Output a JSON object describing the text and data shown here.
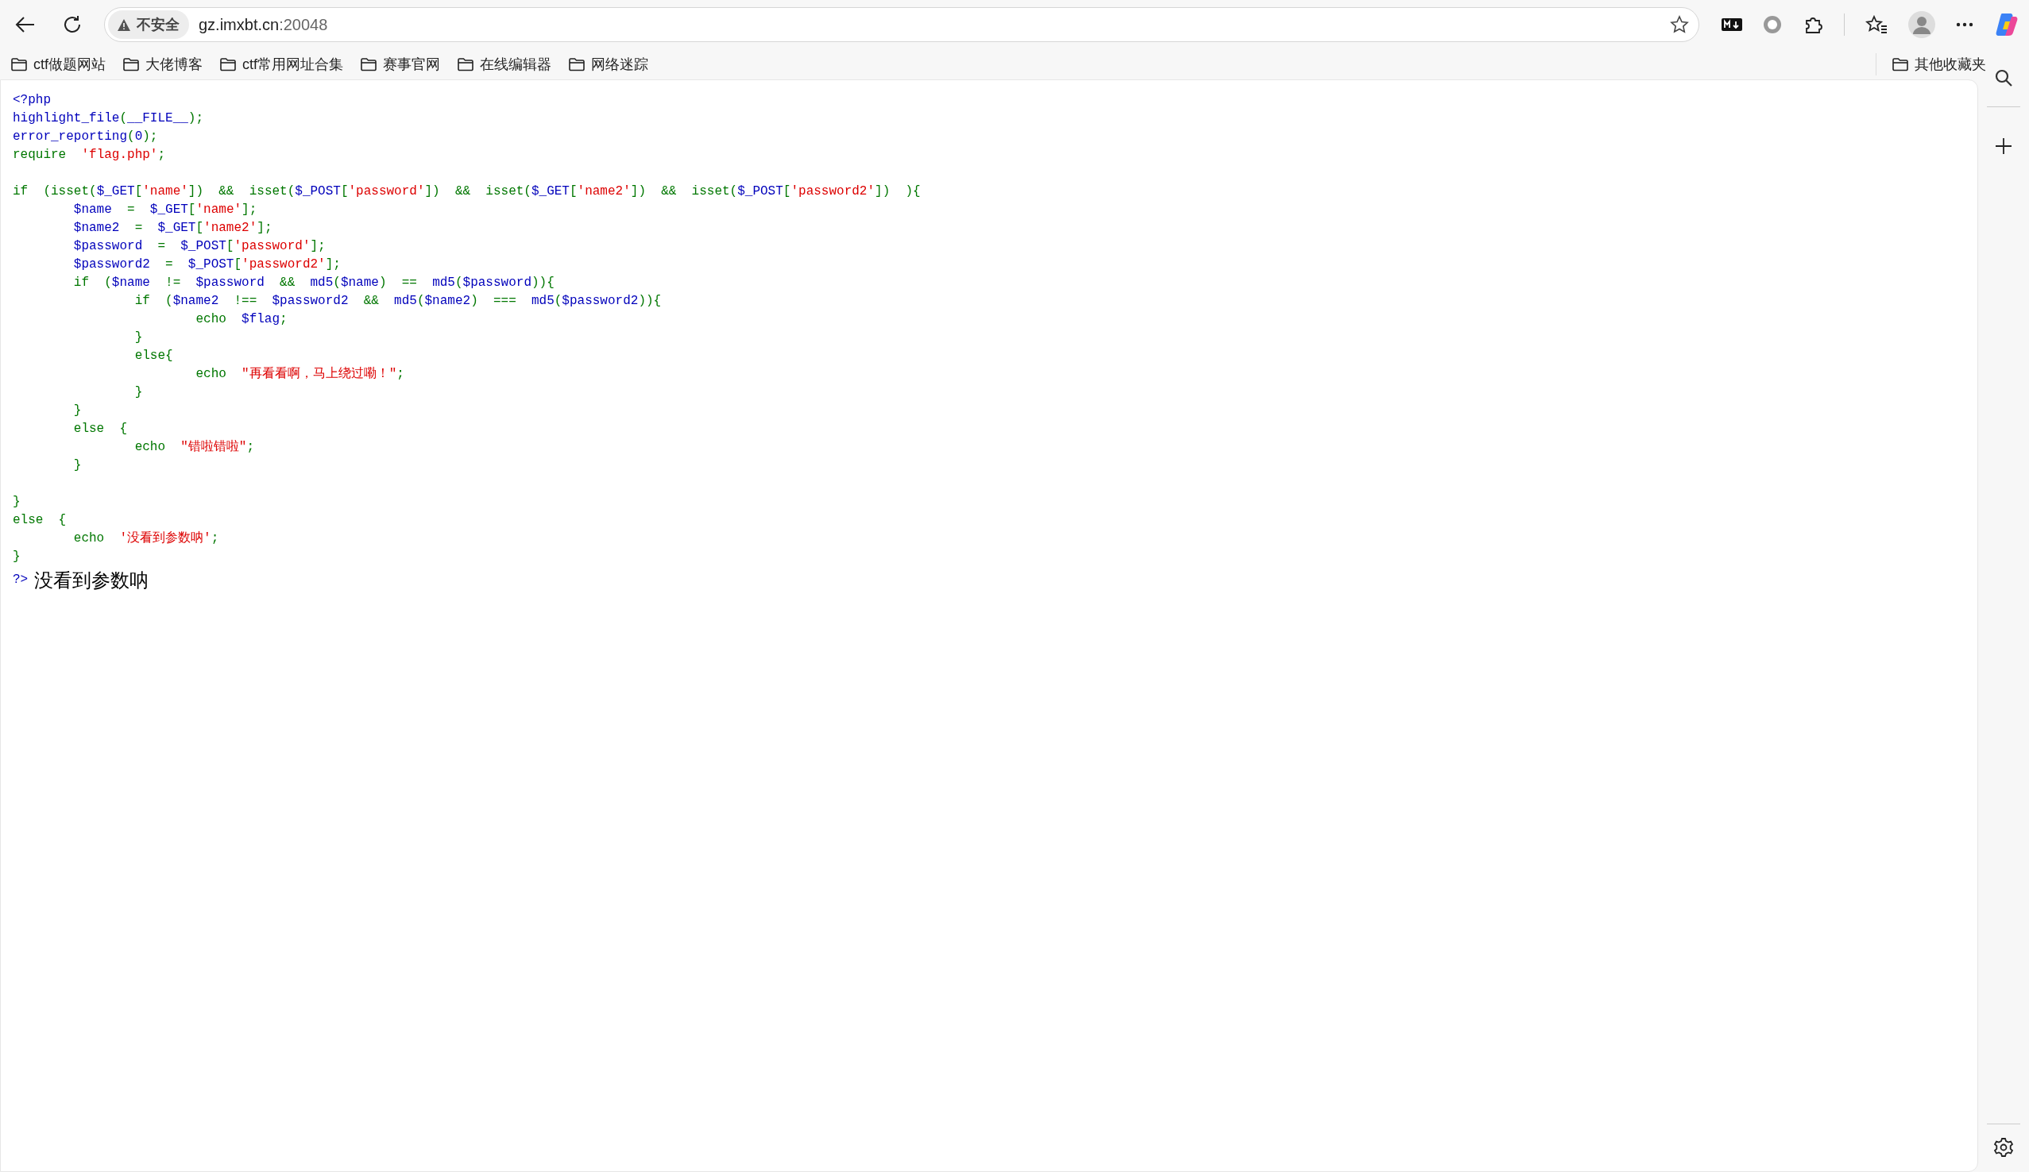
{
  "browser": {
    "address_bar": {
      "security_label": "不安全",
      "host": "gz.imxbt.cn",
      "port": ":20048"
    },
    "bookmarks": [
      {
        "label": "ctf做题网站"
      },
      {
        "label": "大佬博客"
      },
      {
        "label": "ctf常用网址合集"
      },
      {
        "label": "赛事官网"
      },
      {
        "label": "在线编辑器"
      },
      {
        "label": "网络迷踪"
      }
    ],
    "other_bookmarks": "其他收藏夹"
  },
  "code": {
    "blocks": [
      {
        "lines": [
          [
            {
              "kind": "default",
              "text": "<?php"
            }
          ],
          [
            {
              "kind": "default",
              "text": "highlight_file"
            },
            {
              "kind": "keyword",
              "text": "("
            },
            {
              "kind": "default",
              "text": "__FILE__"
            },
            {
              "kind": "keyword",
              "text": ");"
            }
          ],
          [
            {
              "kind": "default",
              "text": "error_reporting"
            },
            {
              "kind": "keyword",
              "text": "("
            },
            {
              "kind": "default",
              "text": "0"
            },
            {
              "kind": "keyword",
              "text": ");"
            }
          ],
          [
            {
              "kind": "keyword",
              "text": "require  "
            },
            {
              "kind": "string",
              "text": "'flag.php'"
            },
            {
              "kind": "keyword",
              "text": ";"
            }
          ]
        ]
      },
      {
        "lines": [
          [
            {
              "kind": "keyword",
              "text": "if  (isset("
            },
            {
              "kind": "default",
              "text": "$_GET"
            },
            {
              "kind": "keyword",
              "text": "["
            },
            {
              "kind": "string",
              "text": "'name'"
            },
            {
              "kind": "keyword",
              "text": "])  &&  isset("
            },
            {
              "kind": "default",
              "text": "$_POST"
            },
            {
              "kind": "keyword",
              "text": "["
            },
            {
              "kind": "string",
              "text": "'password'"
            },
            {
              "kind": "keyword",
              "text": "])  &&  isset("
            },
            {
              "kind": "default",
              "text": "$_GET"
            },
            {
              "kind": "keyword",
              "text": "["
            },
            {
              "kind": "string",
              "text": "'name2'"
            },
            {
              "kind": "keyword",
              "text": "])  &&  isset("
            },
            {
              "kind": "default",
              "text": "$_POST"
            },
            {
              "kind": "keyword",
              "text": "["
            },
            {
              "kind": "string",
              "text": "'password2'"
            },
            {
              "kind": "keyword",
              "text": "])  ){"
            }
          ],
          [
            {
              "kind": "default",
              "text": "        $name  "
            },
            {
              "kind": "keyword",
              "text": "=  "
            },
            {
              "kind": "default",
              "text": "$_GET"
            },
            {
              "kind": "keyword",
              "text": "["
            },
            {
              "kind": "string",
              "text": "'name'"
            },
            {
              "kind": "keyword",
              "text": "];"
            }
          ],
          [
            {
              "kind": "default",
              "text": "        $name2  "
            },
            {
              "kind": "keyword",
              "text": "=  "
            },
            {
              "kind": "default",
              "text": "$_GET"
            },
            {
              "kind": "keyword",
              "text": "["
            },
            {
              "kind": "string",
              "text": "'name2'"
            },
            {
              "kind": "keyword",
              "text": "];"
            }
          ],
          [
            {
              "kind": "default",
              "text": "        $password  "
            },
            {
              "kind": "keyword",
              "text": "=  "
            },
            {
              "kind": "default",
              "text": "$_POST"
            },
            {
              "kind": "keyword",
              "text": "["
            },
            {
              "kind": "string",
              "text": "'password'"
            },
            {
              "kind": "keyword",
              "text": "];"
            }
          ],
          [
            {
              "kind": "default",
              "text": "        $password2  "
            },
            {
              "kind": "keyword",
              "text": "=  "
            },
            {
              "kind": "default",
              "text": "$_POST"
            },
            {
              "kind": "keyword",
              "text": "["
            },
            {
              "kind": "string",
              "text": "'password2'"
            },
            {
              "kind": "keyword",
              "text": "];"
            }
          ],
          [
            {
              "kind": "keyword",
              "text": "        if  ("
            },
            {
              "kind": "default",
              "text": "$name  "
            },
            {
              "kind": "keyword",
              "text": "!=  "
            },
            {
              "kind": "default",
              "text": "$password  "
            },
            {
              "kind": "keyword",
              "text": "&&  "
            },
            {
              "kind": "default",
              "text": "md5"
            },
            {
              "kind": "keyword",
              "text": "("
            },
            {
              "kind": "default",
              "text": "$name"
            },
            {
              "kind": "keyword",
              "text": ")  ==  "
            },
            {
              "kind": "default",
              "text": "md5"
            },
            {
              "kind": "keyword",
              "text": "("
            },
            {
              "kind": "default",
              "text": "$password"
            },
            {
              "kind": "keyword",
              "text": ")){"
            }
          ],
          [
            {
              "kind": "keyword",
              "text": "                if  ("
            },
            {
              "kind": "default",
              "text": "$name2  "
            },
            {
              "kind": "keyword",
              "text": "!==  "
            },
            {
              "kind": "default",
              "text": "$password2  "
            },
            {
              "kind": "keyword",
              "text": "&&  "
            },
            {
              "kind": "default",
              "text": "md5"
            },
            {
              "kind": "keyword",
              "text": "("
            },
            {
              "kind": "default",
              "text": "$name2"
            },
            {
              "kind": "keyword",
              "text": ")  ===  "
            },
            {
              "kind": "default",
              "text": "md5"
            },
            {
              "kind": "keyword",
              "text": "("
            },
            {
              "kind": "default",
              "text": "$password2"
            },
            {
              "kind": "keyword",
              "text": ")){"
            }
          ],
          [
            {
              "kind": "keyword",
              "text": "                        echo  "
            },
            {
              "kind": "default",
              "text": "$flag"
            },
            {
              "kind": "keyword",
              "text": ";"
            }
          ],
          [
            {
              "kind": "keyword",
              "text": "                }"
            }
          ],
          [
            {
              "kind": "keyword",
              "text": "                else{"
            }
          ],
          [
            {
              "kind": "keyword",
              "text": "                        echo  "
            },
            {
              "kind": "string",
              "text": "\"再看看啊，马上绕过嘞！\""
            },
            {
              "kind": "keyword",
              "text": ";"
            }
          ],
          [
            {
              "kind": "keyword",
              "text": "                }"
            }
          ],
          [
            {
              "kind": "keyword",
              "text": "        }"
            }
          ],
          [
            {
              "kind": "keyword",
              "text": "        else  {"
            }
          ],
          [
            {
              "kind": "keyword",
              "text": "                echo  "
            },
            {
              "kind": "string",
              "text": "\"错啦错啦\""
            },
            {
              "kind": "keyword",
              "text": ";"
            }
          ],
          [
            {
              "kind": "keyword",
              "text": "        }"
            }
          ]
        ]
      },
      {
        "lines": [
          [
            {
              "kind": "keyword",
              "text": "}"
            }
          ],
          [
            {
              "kind": "keyword",
              "text": "else  {"
            }
          ],
          [
            {
              "kind": "keyword",
              "text": "        echo  "
            },
            {
              "kind": "string",
              "text": "'没看到参数呐'"
            },
            {
              "kind": "keyword",
              "text": ";"
            }
          ],
          [
            {
              "kind": "keyword",
              "text": "}"
            }
          ]
        ]
      }
    ],
    "closing_tag": "?>"
  },
  "output": "没看到参数呐"
}
